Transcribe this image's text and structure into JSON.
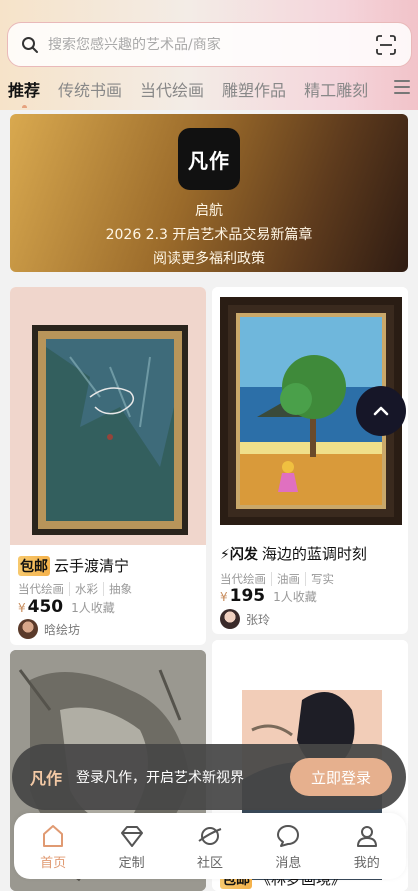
{
  "search": {
    "placeholder": "搜索您感兴趣的艺术品/商家"
  },
  "tabs": [
    "推荐",
    "传统书画",
    "当代绘画",
    "雕塑作品",
    "精工雕刻"
  ],
  "banner": {
    "logo": "凡作",
    "title": "启航",
    "line1": "2026 2.3 开启艺术品交易新篇章",
    "line2": "阅读更多福利政策"
  },
  "products": [
    {
      "badge": "包邮",
      "title": "云手渡清宁",
      "tags": [
        "当代绘画",
        "水彩",
        "抽象"
      ],
      "price": "450",
      "favorites": "1人收藏",
      "seller": "晗绘坊"
    },
    {
      "badge": "闪发",
      "title": "海边的蓝调时刻",
      "tags": [
        "当代绘画",
        "油画",
        "写实"
      ],
      "price": "195",
      "favorites": "1人收藏",
      "seller": "张玲"
    },
    {
      "badge": "包邮",
      "title": "《林梦画境》",
      "tags": [],
      "price": "",
      "favorites": "",
      "seller": ""
    }
  ],
  "currency": "¥",
  "login_bar": {
    "logo": "凡作",
    "text": "登录凡作，开启艺术新视界",
    "button": "立即登录"
  },
  "bottom_nav": [
    {
      "label": "首页",
      "icon": "home-icon",
      "active": true
    },
    {
      "label": "定制",
      "icon": "diamond-icon",
      "active": false
    },
    {
      "label": "社区",
      "icon": "planet-icon",
      "active": false
    },
    {
      "label": "消息",
      "icon": "message-icon",
      "active": false
    },
    {
      "label": "我的",
      "icon": "user-icon",
      "active": false
    }
  ],
  "colors": {
    "accent": "#e09a72",
    "banner_dark": "#2e1b12",
    "banner_gold": "#d9a94f"
  }
}
